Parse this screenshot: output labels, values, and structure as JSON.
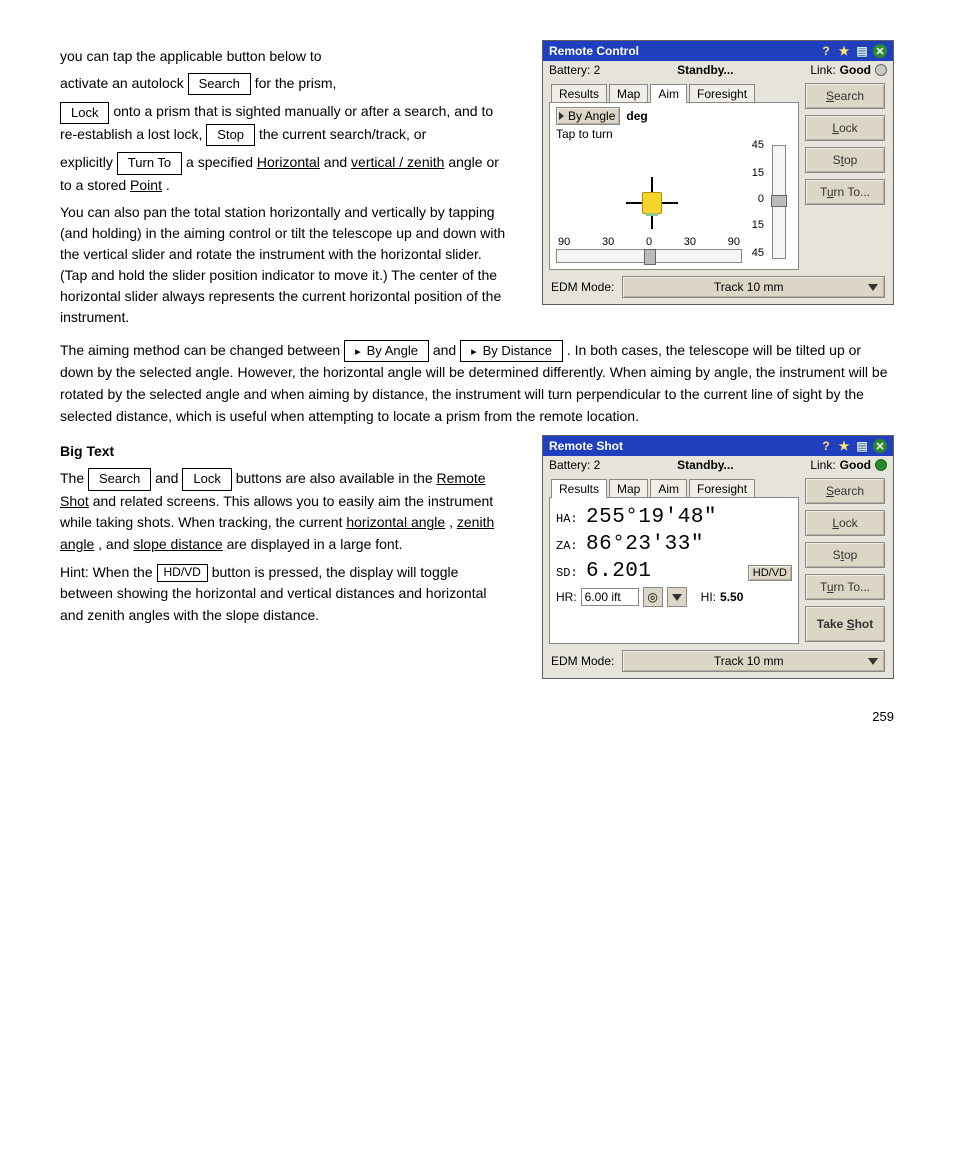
{
  "intro_before_btn": " you can tap the applicable button below to ",
  "sec1": {
    "prefix": "activate an autolock ",
    "btn": "Search",
    "suffix": " for the prism,"
  },
  "sec2": {
    "btn": "Lock",
    "text1": " onto a prism that is sighted manually or after a search, and to re-establish a lost lock, "
  },
  "sec2_line2": {
    "after": "the current search/track, or ",
    "btn": "Stop"
  },
  "sec3": {
    "pre": "explicitly ",
    "btn": "Turn To",
    "post1": " a specified ",
    "u1": "Horizontal",
    "post2": " and ",
    "u2": "vertical / zenith",
    "post3": " angle or to a stored ",
    "u3": "Point",
    "post4": "."
  },
  "also_para": "You can also pan the total station horizontally and vertically by tapping (and holding) in the aiming control or tilt the telescope up and down with the vertical slider and rotate the instrument with the horizontal slider. (Tap and hold the slider position indicator to move it.) The center of the horizontal slider always represents the current horizontal position of the instrument.",
  "aim_methods_para": {
    "pre": "The aiming method can be changed between ",
    "btn1": "▸By Angle",
    "mid": " and ",
    "btn2": "▸By Distance",
    "post": ". In both cases, the telescope will be tilted up or down by the selected angle. However, the horizontal angle will be determined differently. When aiming by angle, the instrument will be rotated by the selected angle and when aiming by distance, the instrument will turn perpendicular to the current line of sight by the selected distance, which is useful when attempting to locate a prism from the remote location."
  },
  "big_text": "Big Text",
  "big_text_para": {
    "pre": "The ",
    "btn1": "Search",
    "mid": " and ",
    "btn2": "Lock",
    "post1": " buttons are also available in the ",
    "u1": "Remote Shot",
    "post2": " and related screens. This allows you to easily aim the instrument while taking shots. When tracking, the current ",
    "u2": "horizontal angle",
    "post3": ", ",
    "u3": "zenith angle",
    "post4": ", and ",
    "u4": "slope distance",
    "post5": " are displayed in a large font."
  },
  "hint_para": {
    "pre": "Hint: When the ",
    "btn": "HD/VD",
    "post": " button is pressed, the display will toggle between showing the horizontal and vertical distances and horizontal and zenith angles with the slope distance."
  },
  "app1": {
    "title": "Remote Control",
    "battery": "Battery: 2",
    "status": "Standby...",
    "link_label": "Link:",
    "link_value": "Good",
    "tabs": [
      "Results",
      "Map",
      "Aim",
      "Foresight"
    ],
    "active_tab": "Aim",
    "by_angle": "By Angle",
    "deg": "deg",
    "tap_to_turn": "Tap to turn",
    "v_ticks": [
      "45",
      "15",
      "0",
      "15",
      "45"
    ],
    "h_ticks": [
      "90",
      "30",
      "0",
      "30",
      "90"
    ],
    "side": [
      "Search",
      "Lock",
      "Stop",
      "Turn To..."
    ],
    "edm_label": "EDM Mode:",
    "edm_value": "Track 10 mm"
  },
  "app2": {
    "title": "Remote Shot",
    "battery": "Battery: 2",
    "status": "Standby...",
    "link_label": "Link:",
    "link_value": "Good",
    "tabs": [
      "Results",
      "Map",
      "Aim",
      "Foresight"
    ],
    "active_tab": "Results",
    "ha_label": "HA:",
    "ha_value": "255°19'48\"",
    "za_label": "ZA:",
    "za_value": "86°23'33\"",
    "sd_label": "SD:",
    "sd_value": "6.201",
    "hdvd": "HD/VD",
    "hr_label": "HR:",
    "hr_value": "6.00 ift",
    "hi_label": "HI:",
    "hi_value": "5.50",
    "side": [
      "Search",
      "Lock",
      "Stop",
      "Turn To..."
    ],
    "take_shot": "Take Shot",
    "edm_label": "EDM Mode:",
    "edm_value": "Track 10 mm"
  },
  "page_number": "259"
}
